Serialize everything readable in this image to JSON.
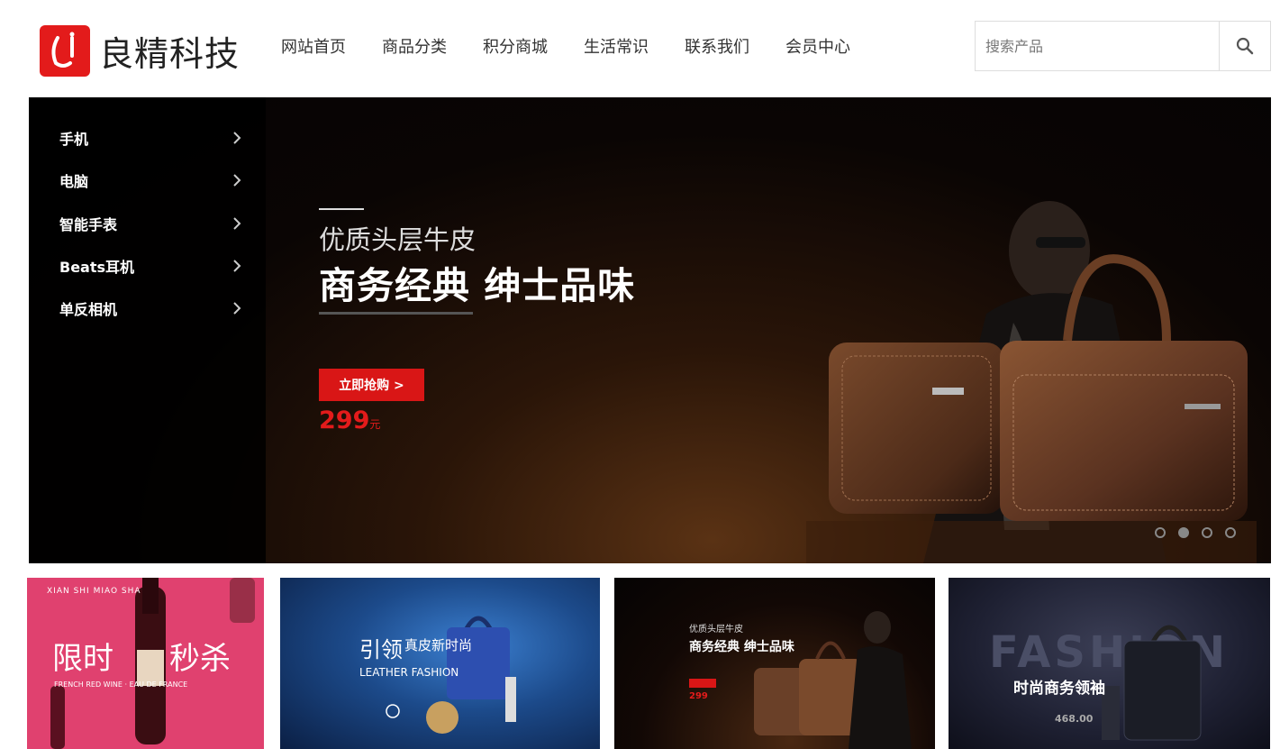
{
  "header": {
    "logo_text": "良精科技",
    "nav": [
      "网站首页",
      "商品分类",
      "积分商城",
      "生活常识",
      "联系我们",
      "会员中心"
    ],
    "search_placeholder": "搜索产品"
  },
  "sidebar": {
    "items": [
      {
        "label": "手机"
      },
      {
        "label": "电脑"
      },
      {
        "label": "智能手表"
      },
      {
        "label": "Beats耳机"
      },
      {
        "label": "单反相机"
      }
    ]
  },
  "hero": {
    "subtitle": "优质头层牛皮",
    "title": "商务经典 绅士品味",
    "button_label": "立即抢购 >",
    "price": "299",
    "price_unit": "元",
    "slides": 4,
    "active_slide": 2
  },
  "tiles": [
    {
      "title": "限时",
      "title2": "秒杀",
      "sub": "FRENCH RED WINE · EAU DE FRANCE",
      "top_labels": "XIAN   SHI   MIAO   SHA"
    },
    {
      "title": "引领",
      "title2": "真皮新时尚",
      "sub": "LEATHER FASHION"
    },
    {
      "title": "优质头层牛皮",
      "title2": "商务经典 绅士品味",
      "price": "299"
    },
    {
      "title": "时尚商务领袖",
      "sub": "FASHION",
      "price": "468.00"
    }
  ],
  "colors": {
    "brand_red": "#e31b1b",
    "banner_dark": "#050303",
    "tile_pink": "#e0416f"
  }
}
